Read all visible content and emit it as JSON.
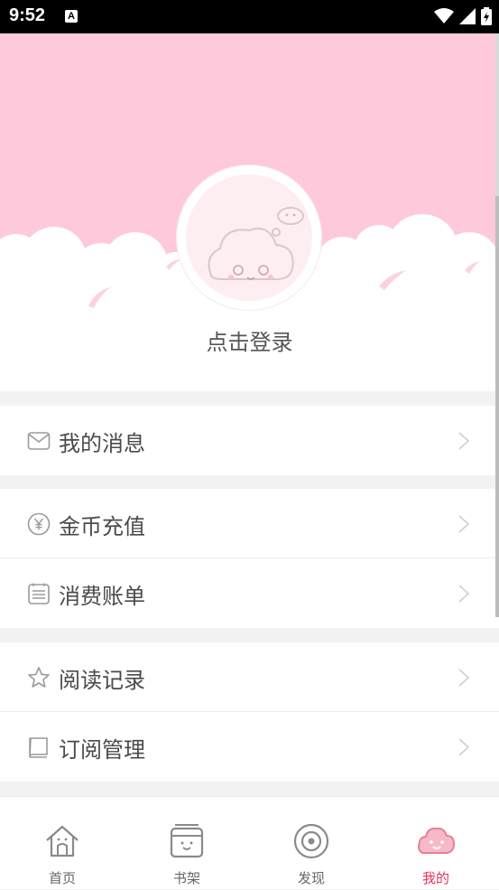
{
  "status_bar": {
    "time": "9:52",
    "notification_letter": "A"
  },
  "header": {
    "login_prompt": "点击登录"
  },
  "menu": {
    "groups": [
      {
        "items": [
          {
            "label": "我的消息",
            "icon": "envelope-icon"
          }
        ]
      },
      {
        "items": [
          {
            "label": "金币充值",
            "icon": "yen-coin-icon"
          },
          {
            "label": "消费账单",
            "icon": "bill-list-icon"
          }
        ]
      },
      {
        "items": [
          {
            "label": "阅读记录",
            "icon": "star-icon"
          },
          {
            "label": "订阅管理",
            "icon": "book-icon"
          }
        ]
      }
    ]
  },
  "bottom_nav": {
    "tabs": [
      {
        "label": "首页",
        "icon": "home-icon",
        "active": false
      },
      {
        "label": "书架",
        "icon": "bookshelf-icon",
        "active": false
      },
      {
        "label": "发现",
        "icon": "discover-icon",
        "active": false
      },
      {
        "label": "我的",
        "icon": "cloud-face-icon",
        "active": true
      }
    ]
  },
  "colors": {
    "header_pink": "#ffc9dc",
    "active_tab": "#e8325a",
    "text_main": "#4a4a4a",
    "icon_gray": "#9a9a9a"
  }
}
